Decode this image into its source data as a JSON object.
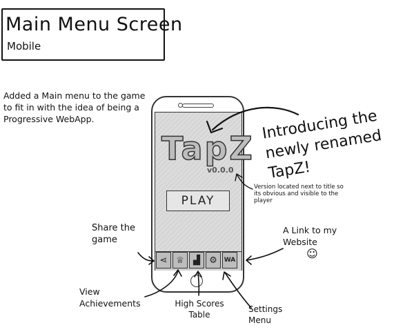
{
  "title": {
    "main": "Main Menu Screen",
    "sub": "Mobile"
  },
  "description": "Added a Main menu to the game to fit in with the idea of being a Progressive WebApp.",
  "phone": {
    "logo": "TapZ",
    "version": "v0.0.0",
    "play_label": "PLAY",
    "tiles": [
      {
        "name": "share-icon",
        "glyph": "⋖"
      },
      {
        "name": "achievements-icon",
        "glyph": "♕"
      },
      {
        "name": "high-scores-icon",
        "glyph": "▟"
      },
      {
        "name": "settings-icon",
        "glyph": "⚙"
      },
      {
        "name": "website-icon",
        "glyph": "WA"
      }
    ]
  },
  "annotations": {
    "intro": "Introducing the newly renamed TapZ!",
    "version_note": "Version located next to title so its obvious and visible to the player",
    "share": "Share the game",
    "website": "A Link to my Website",
    "achievements": "View Achievements",
    "scores": "High Scores Table",
    "settings": "Settings Menu",
    "smiley": "☺"
  }
}
